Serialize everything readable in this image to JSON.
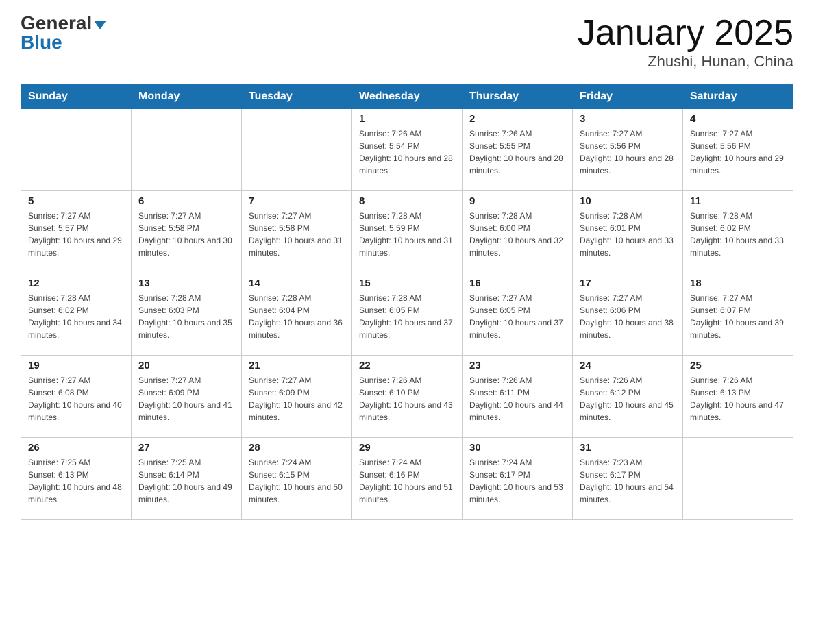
{
  "header": {
    "logo_general": "General",
    "logo_blue": "Blue",
    "title": "January 2025",
    "location": "Zhushi, Hunan, China"
  },
  "days_of_week": [
    "Sunday",
    "Monday",
    "Tuesday",
    "Wednesday",
    "Thursday",
    "Friday",
    "Saturday"
  ],
  "weeks": [
    [
      null,
      null,
      null,
      {
        "day": "1",
        "sunrise": "Sunrise: 7:26 AM",
        "sunset": "Sunset: 5:54 PM",
        "daylight": "Daylight: 10 hours and 28 minutes."
      },
      {
        "day": "2",
        "sunrise": "Sunrise: 7:26 AM",
        "sunset": "Sunset: 5:55 PM",
        "daylight": "Daylight: 10 hours and 28 minutes."
      },
      {
        "day": "3",
        "sunrise": "Sunrise: 7:27 AM",
        "sunset": "Sunset: 5:56 PM",
        "daylight": "Daylight: 10 hours and 28 minutes."
      },
      {
        "day": "4",
        "sunrise": "Sunrise: 7:27 AM",
        "sunset": "Sunset: 5:56 PM",
        "daylight": "Daylight: 10 hours and 29 minutes."
      }
    ],
    [
      {
        "day": "5",
        "sunrise": "Sunrise: 7:27 AM",
        "sunset": "Sunset: 5:57 PM",
        "daylight": "Daylight: 10 hours and 29 minutes."
      },
      {
        "day": "6",
        "sunrise": "Sunrise: 7:27 AM",
        "sunset": "Sunset: 5:58 PM",
        "daylight": "Daylight: 10 hours and 30 minutes."
      },
      {
        "day": "7",
        "sunrise": "Sunrise: 7:27 AM",
        "sunset": "Sunset: 5:58 PM",
        "daylight": "Daylight: 10 hours and 31 minutes."
      },
      {
        "day": "8",
        "sunrise": "Sunrise: 7:28 AM",
        "sunset": "Sunset: 5:59 PM",
        "daylight": "Daylight: 10 hours and 31 minutes."
      },
      {
        "day": "9",
        "sunrise": "Sunrise: 7:28 AM",
        "sunset": "Sunset: 6:00 PM",
        "daylight": "Daylight: 10 hours and 32 minutes."
      },
      {
        "day": "10",
        "sunrise": "Sunrise: 7:28 AM",
        "sunset": "Sunset: 6:01 PM",
        "daylight": "Daylight: 10 hours and 33 minutes."
      },
      {
        "day": "11",
        "sunrise": "Sunrise: 7:28 AM",
        "sunset": "Sunset: 6:02 PM",
        "daylight": "Daylight: 10 hours and 33 minutes."
      }
    ],
    [
      {
        "day": "12",
        "sunrise": "Sunrise: 7:28 AM",
        "sunset": "Sunset: 6:02 PM",
        "daylight": "Daylight: 10 hours and 34 minutes."
      },
      {
        "day": "13",
        "sunrise": "Sunrise: 7:28 AM",
        "sunset": "Sunset: 6:03 PM",
        "daylight": "Daylight: 10 hours and 35 minutes."
      },
      {
        "day": "14",
        "sunrise": "Sunrise: 7:28 AM",
        "sunset": "Sunset: 6:04 PM",
        "daylight": "Daylight: 10 hours and 36 minutes."
      },
      {
        "day": "15",
        "sunrise": "Sunrise: 7:28 AM",
        "sunset": "Sunset: 6:05 PM",
        "daylight": "Daylight: 10 hours and 37 minutes."
      },
      {
        "day": "16",
        "sunrise": "Sunrise: 7:27 AM",
        "sunset": "Sunset: 6:05 PM",
        "daylight": "Daylight: 10 hours and 37 minutes."
      },
      {
        "day": "17",
        "sunrise": "Sunrise: 7:27 AM",
        "sunset": "Sunset: 6:06 PM",
        "daylight": "Daylight: 10 hours and 38 minutes."
      },
      {
        "day": "18",
        "sunrise": "Sunrise: 7:27 AM",
        "sunset": "Sunset: 6:07 PM",
        "daylight": "Daylight: 10 hours and 39 minutes."
      }
    ],
    [
      {
        "day": "19",
        "sunrise": "Sunrise: 7:27 AM",
        "sunset": "Sunset: 6:08 PM",
        "daylight": "Daylight: 10 hours and 40 minutes."
      },
      {
        "day": "20",
        "sunrise": "Sunrise: 7:27 AM",
        "sunset": "Sunset: 6:09 PM",
        "daylight": "Daylight: 10 hours and 41 minutes."
      },
      {
        "day": "21",
        "sunrise": "Sunrise: 7:27 AM",
        "sunset": "Sunset: 6:09 PM",
        "daylight": "Daylight: 10 hours and 42 minutes."
      },
      {
        "day": "22",
        "sunrise": "Sunrise: 7:26 AM",
        "sunset": "Sunset: 6:10 PM",
        "daylight": "Daylight: 10 hours and 43 minutes."
      },
      {
        "day": "23",
        "sunrise": "Sunrise: 7:26 AM",
        "sunset": "Sunset: 6:11 PM",
        "daylight": "Daylight: 10 hours and 44 minutes."
      },
      {
        "day": "24",
        "sunrise": "Sunrise: 7:26 AM",
        "sunset": "Sunset: 6:12 PM",
        "daylight": "Daylight: 10 hours and 45 minutes."
      },
      {
        "day": "25",
        "sunrise": "Sunrise: 7:26 AM",
        "sunset": "Sunset: 6:13 PM",
        "daylight": "Daylight: 10 hours and 47 minutes."
      }
    ],
    [
      {
        "day": "26",
        "sunrise": "Sunrise: 7:25 AM",
        "sunset": "Sunset: 6:13 PM",
        "daylight": "Daylight: 10 hours and 48 minutes."
      },
      {
        "day": "27",
        "sunrise": "Sunrise: 7:25 AM",
        "sunset": "Sunset: 6:14 PM",
        "daylight": "Daylight: 10 hours and 49 minutes."
      },
      {
        "day": "28",
        "sunrise": "Sunrise: 7:24 AM",
        "sunset": "Sunset: 6:15 PM",
        "daylight": "Daylight: 10 hours and 50 minutes."
      },
      {
        "day": "29",
        "sunrise": "Sunrise: 7:24 AM",
        "sunset": "Sunset: 6:16 PM",
        "daylight": "Daylight: 10 hours and 51 minutes."
      },
      {
        "day": "30",
        "sunrise": "Sunrise: 7:24 AM",
        "sunset": "Sunset: 6:17 PM",
        "daylight": "Daylight: 10 hours and 53 minutes."
      },
      {
        "day": "31",
        "sunrise": "Sunrise: 7:23 AM",
        "sunset": "Sunset: 6:17 PM",
        "daylight": "Daylight: 10 hours and 54 minutes."
      },
      null
    ]
  ]
}
